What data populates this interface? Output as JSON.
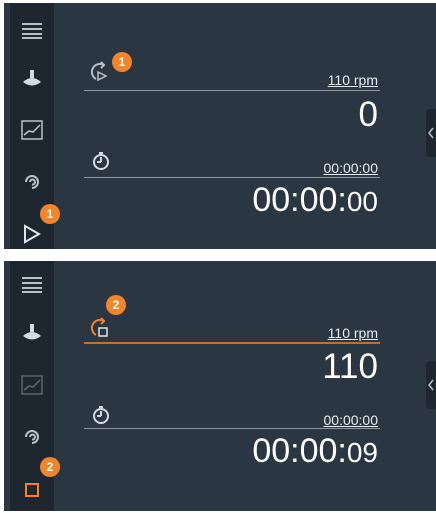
{
  "colors": {
    "panel_bg": "#2a3641",
    "sidebar_bg": "#1e272f",
    "badge_orange": "#f2842a",
    "running_line": "#c3702b",
    "text": "#ffffff"
  },
  "top_panel": {
    "speed_badge": "1",
    "play_badge": "1",
    "speed_setpoint": "110 rpm",
    "speed_value": "0",
    "timer_setpoint": "00:00:00",
    "timer_main": "00:00:",
    "timer_seconds": "00",
    "start_icon": "play-icon"
  },
  "bottom_panel": {
    "speed_badge": "2",
    "stop_badge": "2",
    "speed_setpoint": "110 rpm",
    "speed_value": "110",
    "timer_setpoint": "00:00:00",
    "timer_main": "00:00:",
    "timer_seconds": "09",
    "stop_icon": "stop-icon"
  },
  "sidebar_icons": [
    "menu-icon",
    "stirrer-icon",
    "graph-icon",
    "rotation-icon"
  ]
}
